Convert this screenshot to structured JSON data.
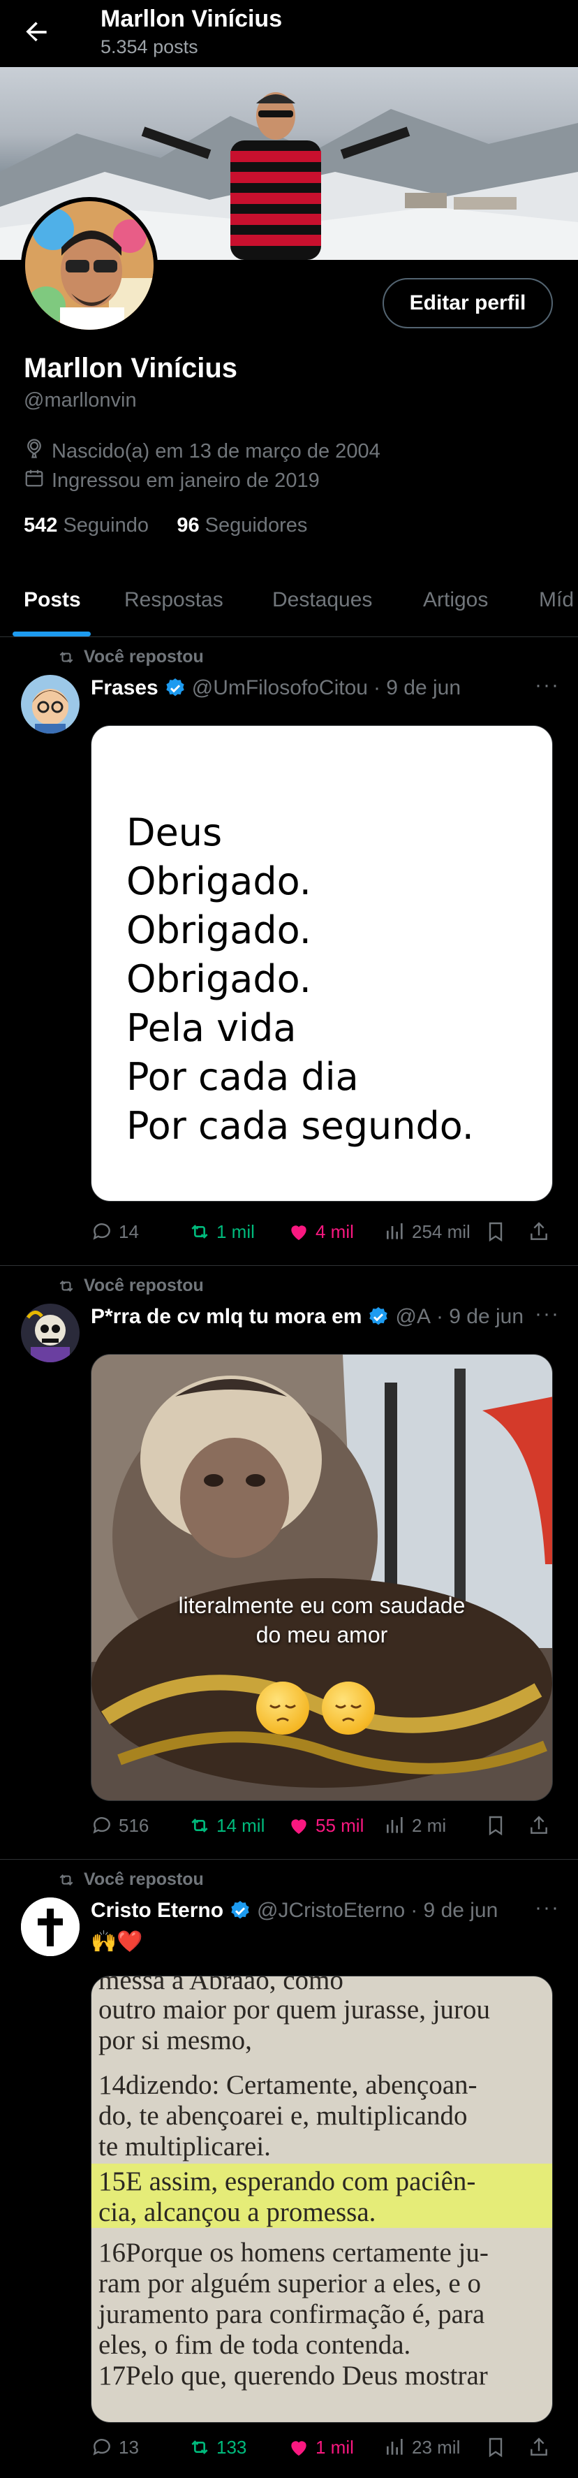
{
  "header": {
    "name": "Marllon Vinícius",
    "posts_count": "5.354 posts"
  },
  "profile": {
    "name": "Marllon Vinícius",
    "handle": "@marllonvin",
    "birth": "Nascido(a) em 13 de março de 2004",
    "joined": "Ingressou em janeiro de 2019",
    "following_count": "542",
    "following_label": "Seguindo",
    "followers_count": "96",
    "followers_label": "Seguidores",
    "edit_label": "Editar perfil"
  },
  "tabs": [
    "Posts",
    "Respostas",
    "Destaques",
    "Artigos",
    "Míd"
  ],
  "posts": [
    {
      "repost_label": "Você repostou",
      "name": "Frases",
      "handle": "@UmFilosofoCitou",
      "date": "· 9 de jun",
      "media_lines": [
        "Deus",
        "Obrigado.",
        "Obrigado.",
        "Obrigado.",
        "Pela vida",
        "Por cada dia",
        "Por cada segundo."
      ],
      "replies": "14",
      "reposts": "1 mil",
      "likes": "4 mil",
      "views": "254 mil"
    },
    {
      "repost_label": "Você repostou",
      "name": "P*rra de cv mlq tu mora em",
      "handle": "@A",
      "date": "· 9 de jun",
      "caption_1": "literalmente eu com saudade",
      "caption_2": "do meu amor",
      "replies": "516",
      "reposts": "14 mil",
      "likes": "55 mil",
      "views": "2 mi"
    },
    {
      "repost_label": "Você repostou",
      "name": "Cristo Eterno",
      "handle": "@JCristoEterno",
      "date": "· 9 de jun",
      "text": "🙌❤️",
      "bible_lines": [
        "messa a Abraão, como",
        "outro maior por quem jurasse, jurou",
        "por si mesmo,",
        "14dizendo: Certamente, abençoan-",
        "do, te abençoarei e, multiplicando",
        "te multiplicarei.",
        "15E assim, esperando com paciên-",
        "cia, alcançou a promessa.",
        "16Porque os homens certamente ju-",
        "ram por alguém superior a eles, e o",
        "juramento para confirmação é, para",
        "eles, o fim de toda contenda.",
        "17Pelo que, querendo Deus mostrar"
      ],
      "replies": "13",
      "reposts": "133",
      "likes": "1 mil",
      "views": "23 mil"
    }
  ],
  "colors": {
    "accent": "#1d9bf0",
    "repost_green": "#00ba7c",
    "like_pink": "#f91880",
    "muted": "#71767b",
    "highlight": "#e8f06a"
  }
}
